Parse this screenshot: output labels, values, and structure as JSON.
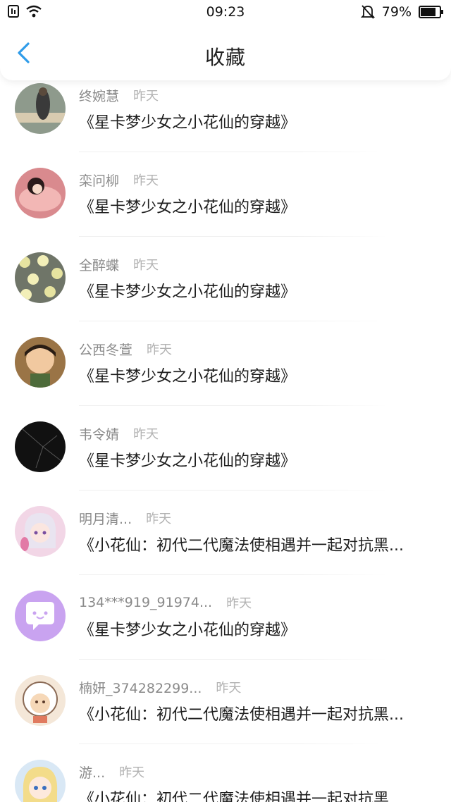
{
  "status_bar": {
    "time": "09:23",
    "battery": "79%"
  },
  "header": {
    "title": "收藏"
  },
  "items": [
    {
      "name": "终婉慧",
      "date": "昨天",
      "content": "《星卡梦少女之小花仙的穿越》",
      "avatar_color": "#8e9a8c"
    },
    {
      "name": "栾问柳",
      "date": "昨天",
      "content": "《星卡梦少女之小花仙的穿越》",
      "avatar_color": "#d98a8e"
    },
    {
      "name": "全醉蝶",
      "date": "昨天",
      "content": "《星卡梦少女之小花仙的穿越》",
      "avatar_color": "#6f7568"
    },
    {
      "name": "公西冬萱",
      "date": "昨天",
      "content": "《星卡梦少女之小花仙的穿越》",
      "avatar_color": "#9a7446"
    },
    {
      "name": "韦令婧",
      "date": "昨天",
      "content": "《星卡梦少女之小花仙的穿越》",
      "avatar_color": "#111111"
    },
    {
      "name": "明月清...",
      "date": "昨天",
      "content": "《小花仙：初代二代魔法使相遇并一起对抗黑...",
      "avatar_color": "#f2d6e6"
    },
    {
      "name": "134***919_91974...",
      "date": "昨天",
      "content": "《星卡梦少女之小花仙的穿越》",
      "avatar_color": "#c9a3f0"
    },
    {
      "name": "楠妍_374282299...",
      "date": "昨天",
      "content": "《小花仙：初代二代魔法使相遇并一起对抗黑...",
      "avatar_color": "#f4e7d8"
    },
    {
      "name": "游...",
      "date": "昨天",
      "content": "《小花仙：初代二代魔法使相遇并一起对抗黑...",
      "avatar_color": "#d9e8f5"
    }
  ],
  "colors": {
    "accent": "#2f9ce9"
  }
}
